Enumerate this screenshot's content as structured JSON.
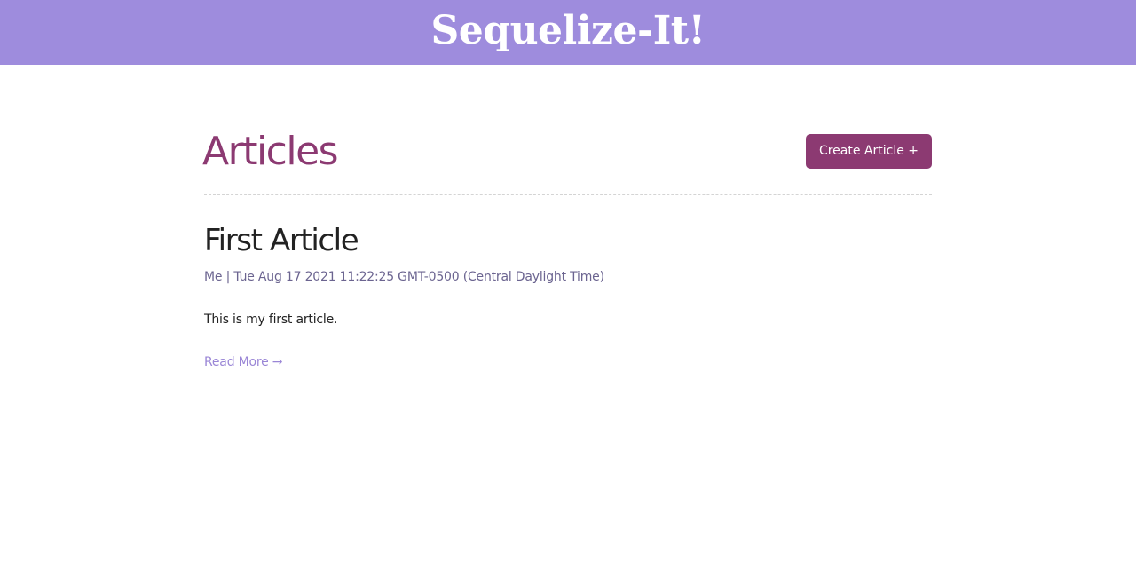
{
  "header": {
    "site_title": "Sequelize-It!"
  },
  "page": {
    "title": "Articles",
    "create_button_label": "Create Article +"
  },
  "articles": [
    {
      "title": "First Article",
      "author": "Me",
      "separator": "|",
      "date": "Tue Aug 17 2021 11:22:25 GMT-0500 (Central Daylight Time)",
      "body": "This is my first article.",
      "read_more": "Read More →"
    }
  ],
  "colors": {
    "header_bg": "#9e8cdd",
    "accent": "#8c3a72",
    "meta": "#6b6490",
    "link": "#9a86d6"
  }
}
